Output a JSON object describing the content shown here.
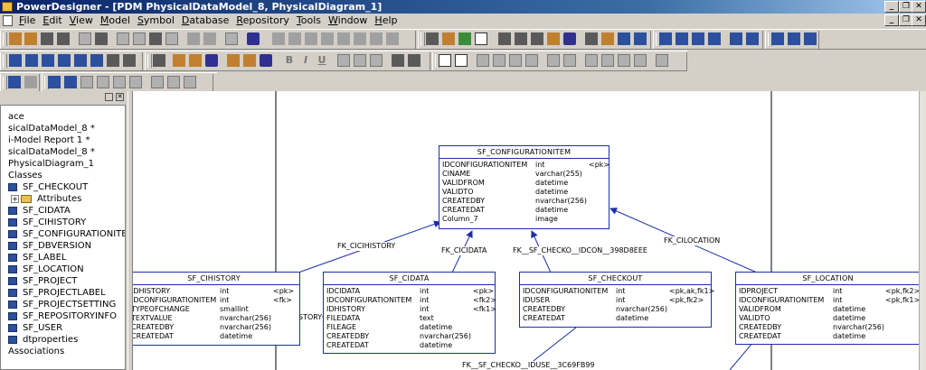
{
  "window": {
    "title": "PowerDesigner - [PDM PhysicalDataModel_8, PhysicalDiagram_1]"
  },
  "menu": [
    "File",
    "Edit",
    "View",
    "Model",
    "Symbol",
    "Database",
    "Repository",
    "Tools",
    "Window",
    "Help"
  ],
  "window_buttons": {
    "minimize": "_",
    "restore": "❐",
    "close": "✕"
  },
  "text_buttons": {
    "bold": "B",
    "italic": "I",
    "underline": "U"
  },
  "browser": {
    "items": [
      {
        "label": "ace"
      },
      {
        "label": "sicalDataModel_8 *"
      },
      {
        "label": "i-Model Report 1 *"
      },
      {
        "label": "sicalDataModel_8 *"
      },
      {
        "label": "PhysicalDiagram_1"
      },
      {
        "label": "Classes"
      },
      {
        "label": "SF_CHECKOUT"
      },
      {
        "label": "Attributes"
      },
      {
        "label": "SF_CIDATA"
      },
      {
        "label": "SF_CIHISTORY"
      },
      {
        "label": "SF_CONFIGURATIONITEM"
      },
      {
        "label": "SF_DBVERSION"
      },
      {
        "label": "SF_LABEL"
      },
      {
        "label": "SF_LOCATION"
      },
      {
        "label": "SF_PROJECT"
      },
      {
        "label": "SF_PROJECTLABEL"
      },
      {
        "label": "SF_PROJECTSETTING"
      },
      {
        "label": "SF_REPOSITORYINFO"
      },
      {
        "label": "SF_USER"
      },
      {
        "label": "dtproperties"
      },
      {
        "label": "Associations"
      }
    ]
  },
  "tables": {
    "configitem": {
      "name": "SF_CONFIGURATIONITEM",
      "rows": [
        [
          "IDCONFIGURATIONITEM",
          "int",
          "<pk>"
        ],
        [
          "CINAME",
          "varchar(255)",
          ""
        ],
        [
          "VALIDFROM",
          "datetime",
          ""
        ],
        [
          "VALIDTO",
          "datetime",
          ""
        ],
        [
          "CREATEDBY",
          "nvarchar(256)",
          ""
        ],
        [
          "CREATEDAT",
          "datetime",
          ""
        ],
        [
          "Column_7",
          "image",
          ""
        ]
      ]
    },
    "cihistory": {
      "name": "SF_CIHISTORY",
      "rows": [
        [
          "IDHISTORY",
          "int",
          "<pk>"
        ],
        [
          "IDCONFIGURATIONITEM",
          "int",
          "<fk>"
        ],
        [
          "TYPEOFCHANGE",
          "smallint",
          ""
        ],
        [
          "TEXTVALUE",
          "nvarchar(256)",
          ""
        ],
        [
          "CREATEDBY",
          "nvarchar(256)",
          ""
        ],
        [
          "CREATEDAT",
          "datetime",
          ""
        ]
      ]
    },
    "cidata": {
      "name": "SF_CIDATA",
      "rows": [
        [
          "IDCIDATA",
          "int",
          "<pk>"
        ],
        [
          "IDCONFIGURATIONITEM",
          "int",
          "<fk2>"
        ],
        [
          "IDHISTORY",
          "int",
          "<fk1>"
        ],
        [
          "FILEDATA",
          "text",
          ""
        ],
        [
          "FILEAGE",
          "datetime",
          ""
        ],
        [
          "CREATEDBY",
          "nvarchar(256)",
          ""
        ],
        [
          "CREATEDAT",
          "datetime",
          ""
        ]
      ]
    },
    "checkout": {
      "name": "SF_CHECKOUT",
      "rows": [
        [
          "IDCONFIGURATIONITEM",
          "int",
          "<pk,ak,fk1>"
        ],
        [
          "IDUSER",
          "int",
          "<pk,fk2>"
        ],
        [
          "CREATEDBY",
          "nvarchar(256)",
          ""
        ],
        [
          "CREATEDAT",
          "datetime",
          ""
        ]
      ]
    },
    "location": {
      "name": "SF_LOCATION",
      "rows": [
        [
          "IDPROJECT",
          "int",
          "<pk,fk2>"
        ],
        [
          "IDCONFIGURATIONITEM",
          "int",
          "<pk,fk1>"
        ],
        [
          "VALIDFROM",
          "datetime",
          ""
        ],
        [
          "VALIDTO",
          "datetime",
          ""
        ],
        [
          "CREATEDBY",
          "nvarchar(256)",
          ""
        ],
        [
          "CREATEDAT",
          "datetime",
          ""
        ]
      ]
    }
  },
  "references": {
    "fk_cihistory": "FK_CICIHISTORY",
    "fk_cidata": "FK_CICIDATA",
    "fk_checkout_con": "FK__SF_CHECKO__IDCON__398D8EEE",
    "fk_cilocation": "FK_CILOCATION",
    "fk_history_partial": "STORY",
    "fk_checkout_iduse": "FK__SF_CHECKO__IDUSE__3C69FB99"
  },
  "colors": {
    "title_start": "#0a246a",
    "table_border": "#1c2fa8",
    "chrome": "#d4d0c8"
  }
}
